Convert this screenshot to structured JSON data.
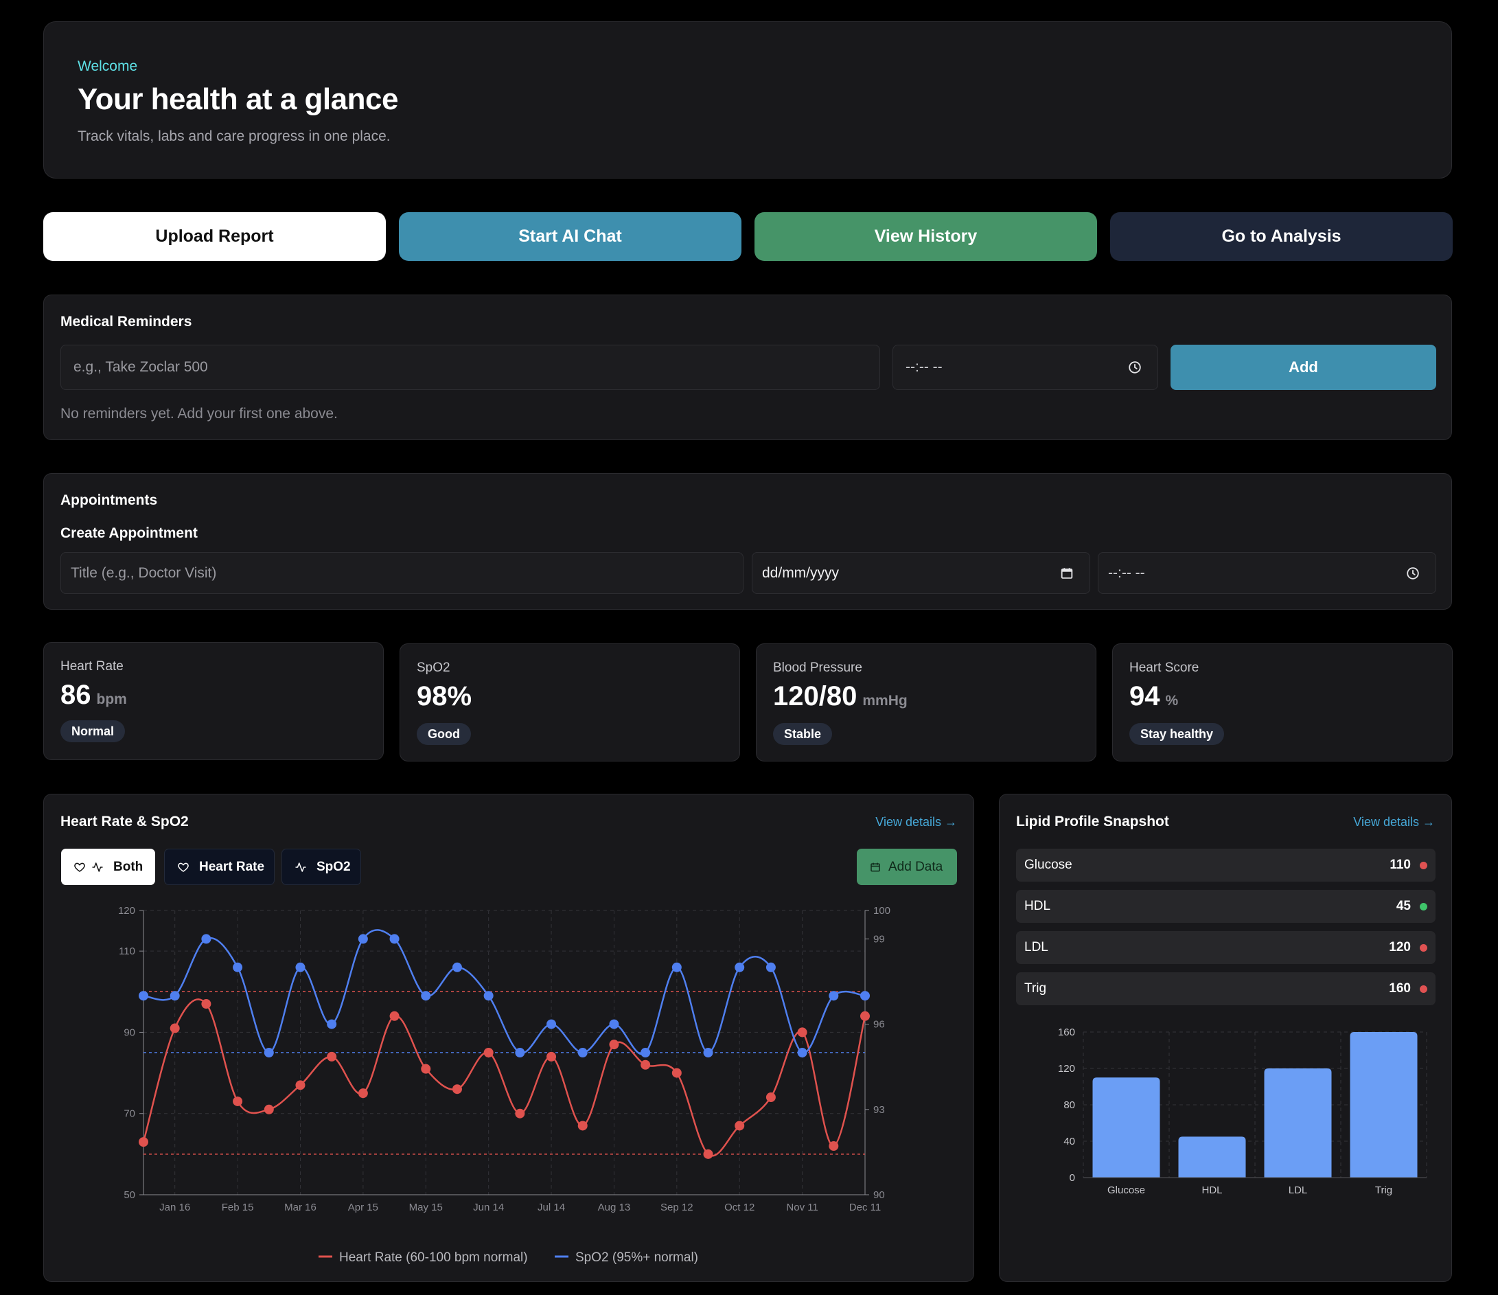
{
  "hero": {
    "welcome": "Welcome",
    "title": "Your health at a glance",
    "subtitle": "Track vitals, labs and care progress in one place."
  },
  "actions": {
    "upload": "Upload Report",
    "chat": "Start AI Chat",
    "history": "View History",
    "analysis": "Go to Analysis"
  },
  "reminders": {
    "title": "Medical Reminders",
    "input_placeholder": "e.g., Take Zoclar 500",
    "time_placeholder": "--:-- --",
    "add_label": "Add",
    "empty_text": "No reminders yet. Add your first one above."
  },
  "appointments": {
    "title": "Appointments",
    "create_title": "Create Appointment",
    "title_placeholder": "Title (e.g., Doctor Visit)",
    "date_placeholder": "dd/mm/yyyy",
    "time_placeholder": "--:-- --"
  },
  "stats": [
    {
      "label": "Heart Rate",
      "value": "86",
      "unit": "bpm",
      "badge": "Normal"
    },
    {
      "label": "SpO2",
      "value": "98%",
      "unit": "",
      "badge": "Good"
    },
    {
      "label": "Blood Pressure",
      "value": "120/80",
      "unit": "mmHg",
      "badge": "Stable"
    },
    {
      "label": "Heart Score",
      "value": "94",
      "unit": "%",
      "badge": "Stay healthy"
    }
  ],
  "hr_panel": {
    "title": "Heart Rate & SpO2",
    "view_details": "View details →",
    "toggles": {
      "both": "Both",
      "heart_rate": "Heart Rate",
      "spo2": "SpO2"
    },
    "add_data": "Add Data",
    "legend": {
      "hr": "Heart Rate (60-100 bpm normal)",
      "spo2": "SpO2 (95%+ normal)"
    }
  },
  "lipid_panel": {
    "title": "Lipid Profile Snapshot",
    "view_details": "View details →",
    "rows": [
      {
        "name": "Glucose",
        "value": "110",
        "status_color": "#e05252"
      },
      {
        "name": "HDL",
        "value": "45",
        "status_color": "#3fc46a"
      },
      {
        "name": "LDL",
        "value": "120",
        "status_color": "#e05252"
      },
      {
        "name": "Trig",
        "value": "160",
        "status_color": "#e05252"
      }
    ]
  },
  "colors": {
    "hr": "#e0524e",
    "spo2": "#4f7ff0",
    "bar": "#6b9ef5",
    "accent_teal": "#3e8fae",
    "accent_green": "#469468"
  },
  "chart_data": [
    {
      "type": "line",
      "x_ticks": [
        "Jan 16",
        "Feb 15",
        "Mar 16",
        "Apr 15",
        "May 15",
        "Jun 14",
        "Jul 14",
        "Aug 13",
        "Sep 12",
        "Oct 12",
        "Nov 11",
        "Dec 11"
      ],
      "y_left": {
        "ylim": [
          50,
          120
        ],
        "ticks": [
          50,
          70,
          90,
          110,
          120
        ]
      },
      "y_right": {
        "ylim": [
          90,
          100
        ],
        "ticks": [
          90,
          93,
          96,
          99,
          100
        ]
      },
      "reference_lines": {
        "hr": [
          60,
          100
        ],
        "spo2": [
          95
        ]
      },
      "series": [
        {
          "name": "Heart Rate (60-100 bpm normal)",
          "axis": "left",
          "values": [
            63,
            91,
            97,
            73,
            71,
            77,
            84,
            75,
            94,
            81,
            76,
            85,
            70,
            84,
            67,
            87,
            82,
            80,
            60,
            67,
            74,
            90,
            62,
            94
          ]
        },
        {
          "name": "SpO2 (95%+ normal)",
          "axis": "right",
          "values": [
            97,
            97,
            99,
            98,
            95,
            98,
            96,
            99,
            99,
            97,
            98,
            97,
            95,
            96,
            95,
            96,
            95,
            98,
            95,
            98,
            98,
            95,
            97,
            97
          ]
        }
      ],
      "legend": "bottom",
      "grid": true
    },
    {
      "type": "bar",
      "categories": [
        "Glucose",
        "HDL",
        "LDL",
        "Trig"
      ],
      "values": [
        110,
        45,
        120,
        160
      ],
      "ylim": [
        0,
        160
      ],
      "yticks": [
        0,
        40,
        80,
        120,
        160
      ],
      "grid": true
    }
  ]
}
